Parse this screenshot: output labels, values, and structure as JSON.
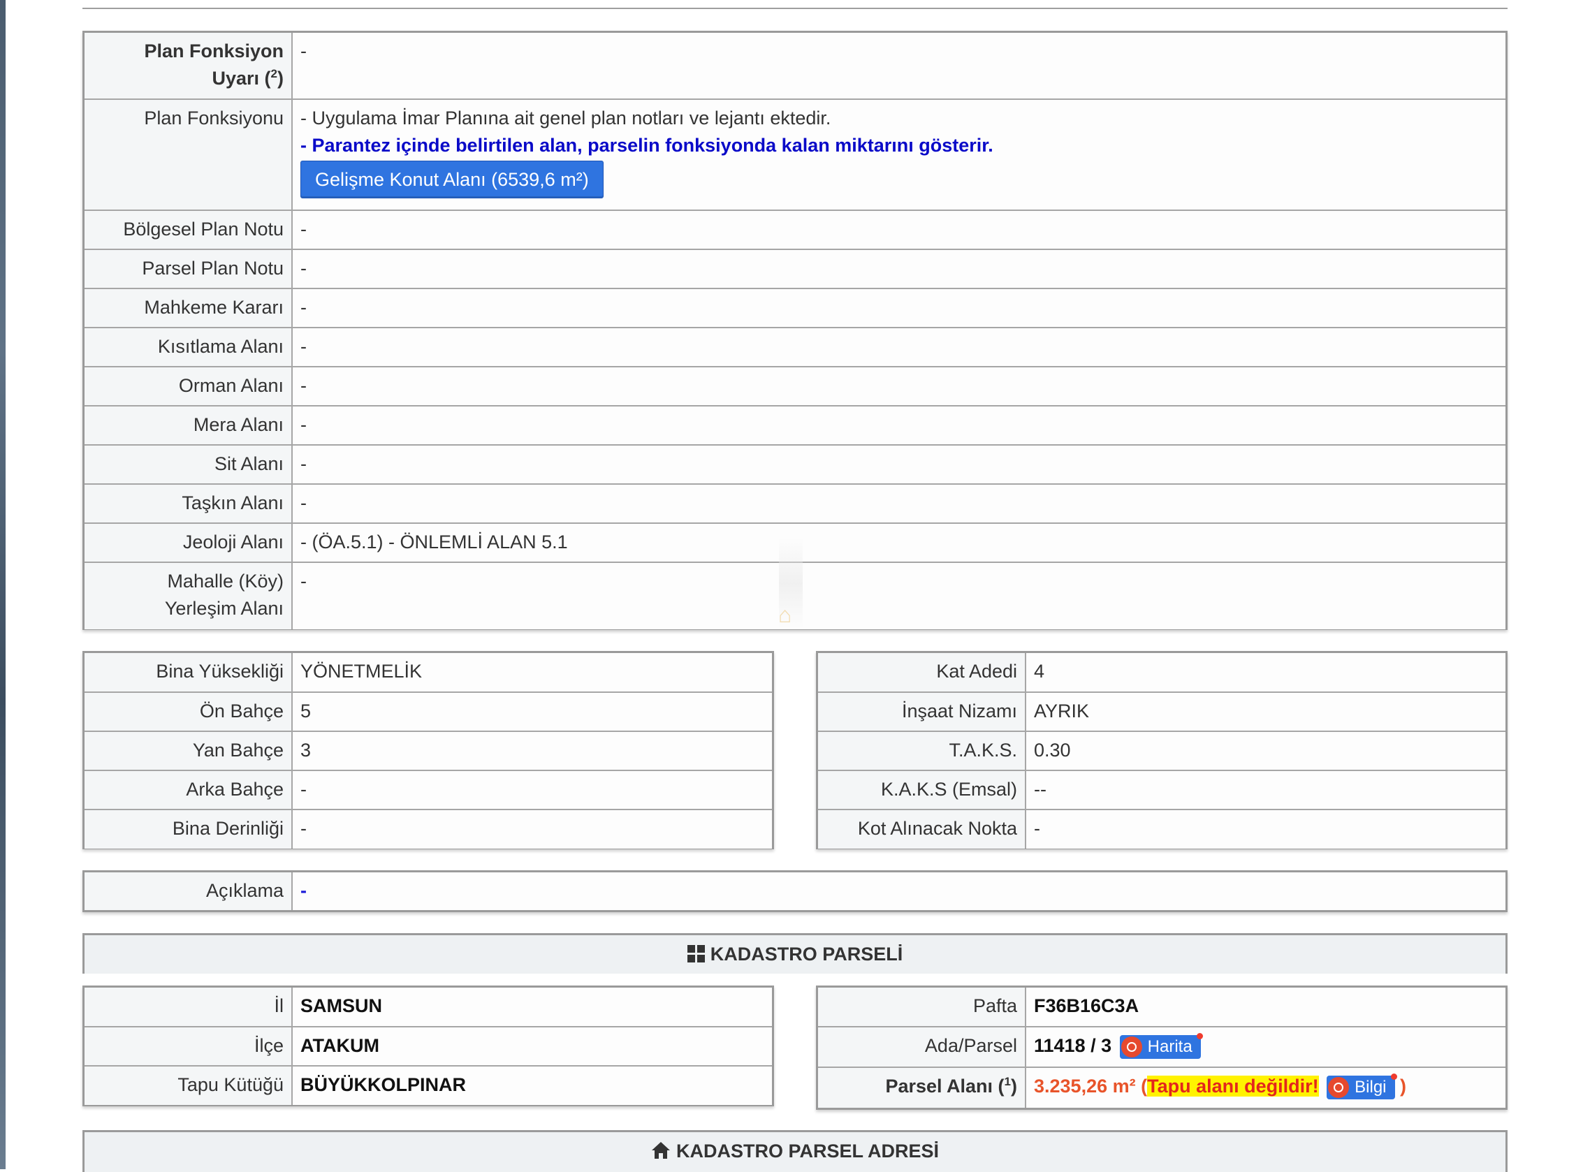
{
  "plan": {
    "rows": [
      {
        "label_line1": "Plan Fonksiyon",
        "label_line2": "Uyarı (",
        "label_sup": "2",
        "label_close": ")",
        "value": "-"
      },
      {
        "label": "Plan Fonksiyonu",
        "note1": "- Uygulama İmar Planına ait genel plan notları ve lejantı ektedir.",
        "note2": "- Parantez içinde belirtilen alan, parselin fonksiyonda kalan miktarını gösterir.",
        "button": "Gelişme Konut Alanı (6539,6 m²)"
      },
      {
        "label": "Bölgesel Plan Notu",
        "value": "-"
      },
      {
        "label": "Parsel Plan Notu",
        "value": "-"
      },
      {
        "label": "Mahkeme Kararı",
        "value": "-"
      },
      {
        "label": "Kısıtlama Alanı",
        "value": "-"
      },
      {
        "label": "Orman Alanı",
        "value": "-"
      },
      {
        "label": "Mera Alanı",
        "value": "-"
      },
      {
        "label": "Sit Alanı",
        "value": "-"
      },
      {
        "label": "Taşkın Alanı",
        "value": "-"
      },
      {
        "label": "Jeoloji Alanı",
        "value": "- (ÖA.5.1) - ÖNLEMLİ ALAN 5.1"
      },
      {
        "label_line1": "Mahalle (Köy)",
        "label_line2": "Yerleşim Alanı",
        "value": "-"
      }
    ]
  },
  "building_left": [
    {
      "label": "Bina Yüksekliği",
      "value": "YÖNETMELİK"
    },
    {
      "label": "Ön Bahçe",
      "value": "5"
    },
    {
      "label": "Yan Bahçe",
      "value": "3"
    },
    {
      "label": "Arka Bahçe",
      "value": "-"
    },
    {
      "label": "Bina Derinliği",
      "value": "-"
    }
  ],
  "building_right": [
    {
      "label": "Kat Adedi",
      "value": "4"
    },
    {
      "label": "İnşaat Nizamı",
      "value": "AYRIK"
    },
    {
      "label": "T.A.K.S.",
      "value": "0.30"
    },
    {
      "label": "K.A.K.S (Emsal)",
      "value": "--"
    },
    {
      "label": "Kot Alınacak Nokta",
      "value": "-"
    }
  ],
  "aciklama": {
    "label": "Açıklama",
    "value": "-"
  },
  "kadastro": {
    "title": "KADASTRO PARSELİ",
    "left": [
      {
        "label": "İl",
        "value": "SAMSUN"
      },
      {
        "label": "İlçe",
        "value": "ATAKUM"
      },
      {
        "label": "Tapu Kütüğü",
        "value": "BÜYÜKKOLPINAR"
      }
    ],
    "pafta": {
      "label": "Pafta",
      "value": "F36B16C3A"
    },
    "ada": {
      "label": "Ada/Parsel",
      "value": "11418 / 3",
      "button": "Harita"
    },
    "alan": {
      "label": "Parsel Alanı (",
      "label_sup": "1",
      "label_close": ")",
      "value": "3.235,26 m²",
      "open": " (",
      "warning": "Tapu alanı değildir!",
      "button": "Bilgi",
      "close": " )"
    }
  },
  "adres": {
    "title": "KADASTRO PARSEL ADRESİ"
  },
  "colors": {
    "accent_blue": "#2f74e0",
    "warning_red": "#e3261d",
    "highlight_yellow": "#fff200"
  }
}
